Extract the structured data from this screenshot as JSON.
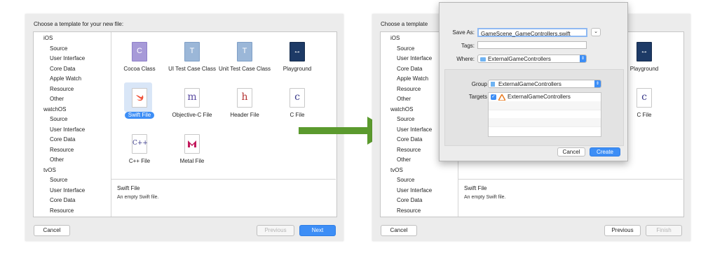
{
  "left": {
    "title": "Choose a template for your new file:",
    "sidebar": [
      {
        "text": "iOS",
        "kind": "platform"
      },
      {
        "text": "Source",
        "kind": "cat"
      },
      {
        "text": "User Interface",
        "kind": "cat"
      },
      {
        "text": "Core Data",
        "kind": "cat"
      },
      {
        "text": "Apple Watch",
        "kind": "cat"
      },
      {
        "text": "Resource",
        "kind": "cat"
      },
      {
        "text": "Other",
        "kind": "cat"
      },
      {
        "text": "watchOS",
        "kind": "platform"
      },
      {
        "text": "Source",
        "kind": "cat"
      },
      {
        "text": "User Interface",
        "kind": "cat"
      },
      {
        "text": "Core Data",
        "kind": "cat"
      },
      {
        "text": "Resource",
        "kind": "cat"
      },
      {
        "text": "Other",
        "kind": "cat"
      },
      {
        "text": "tvOS",
        "kind": "platform"
      },
      {
        "text": "Source",
        "kind": "cat"
      },
      {
        "text": "User Interface",
        "kind": "cat"
      },
      {
        "text": "Core Data",
        "kind": "cat"
      },
      {
        "text": "Resource",
        "kind": "cat"
      }
    ],
    "templates": {
      "cocoa_class": "Cocoa Class",
      "ui_test": "UI Test Case Class",
      "unit_test": "Unit Test Case Class",
      "playground": "Playground",
      "swift_file": "Swift File",
      "objc_file": "Objective-C File",
      "header_file": "Header File",
      "c_file": "C File",
      "cpp_file": "C++ File",
      "metal_file": "Metal File"
    },
    "icon_glyphs": {
      "cocoa": "C",
      "test": "T",
      "objc": "m",
      "header": "h",
      "c": "c",
      "cpp": "C++",
      "playground": "↔"
    },
    "description": {
      "title": "Swift File",
      "text": "An empty Swift file."
    },
    "buttons": {
      "cancel": "Cancel",
      "previous": "Previous",
      "next": "Next"
    }
  },
  "right": {
    "title": "Choose a template",
    "sidebar": [
      {
        "text": "iOS",
        "kind": "platform"
      },
      {
        "text": "Source",
        "kind": "cat"
      },
      {
        "text": "User Interface",
        "kind": "cat"
      },
      {
        "text": "Core Data",
        "kind": "cat"
      },
      {
        "text": "Apple Watch",
        "kind": "cat"
      },
      {
        "text": "Resource",
        "kind": "cat"
      },
      {
        "text": "Other",
        "kind": "cat"
      },
      {
        "text": "watchOS",
        "kind": "platform"
      },
      {
        "text": "Source",
        "kind": "cat"
      },
      {
        "text": "User Interface",
        "kind": "cat"
      },
      {
        "text": "Core Data",
        "kind": "cat"
      },
      {
        "text": "Resource",
        "kind": "cat"
      },
      {
        "text": "Other",
        "kind": "cat"
      },
      {
        "text": "tvOS",
        "kind": "platform"
      },
      {
        "text": "Source",
        "kind": "cat"
      },
      {
        "text": "User Interface",
        "kind": "cat"
      },
      {
        "text": "Core Data",
        "kind": "cat"
      },
      {
        "text": "Resource",
        "kind": "cat"
      }
    ],
    "templates": {
      "playground": "Playground",
      "c_file": "C File"
    },
    "description": {
      "title": "Swift File",
      "text": "An empty Swift file."
    },
    "buttons": {
      "cancel": "Cancel",
      "previous": "Previous",
      "finish": "Finish"
    }
  },
  "dialog": {
    "save_as_label": "Save As:",
    "save_as_value": "GameScene_GameControllers.swift",
    "tags_label": "Tags:",
    "tags_value": "",
    "where_label": "Where:",
    "where_value": "ExternalGameControllers",
    "group_label": "Group",
    "group_value": "ExternalGameControllers",
    "targets_label": "Targets",
    "target_item": "ExternalGameControllers",
    "expand_glyph": "⌄",
    "cancel": "Cancel",
    "create": "Create"
  },
  "colors": {
    "accent": "#3d8ef6",
    "arrow": "#5b9a2e"
  }
}
